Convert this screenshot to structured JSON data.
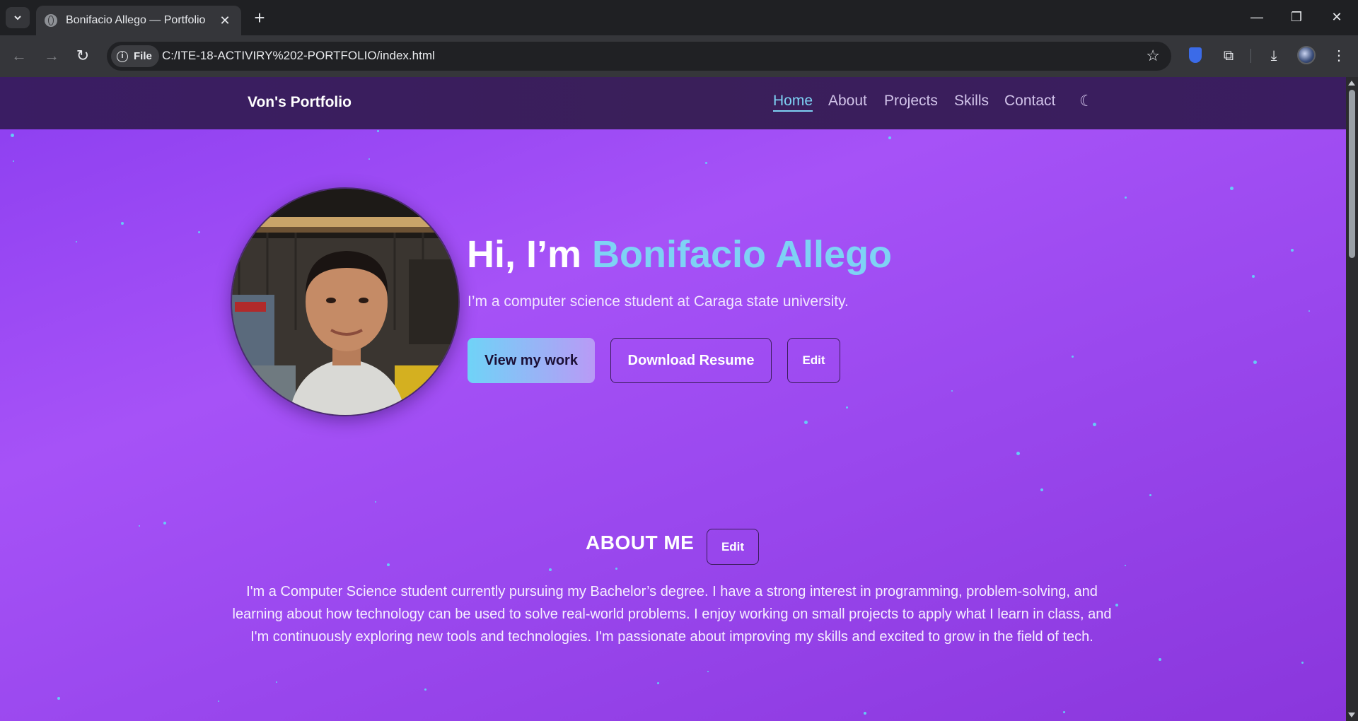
{
  "browser": {
    "tab_title": "Bonifacio Allego — Portfolio",
    "url_chip": "File",
    "url": "C:/ITE-18-ACTIVIRY%202-PORTFOLIO/index.html"
  },
  "site": {
    "brand": "Von's Portfolio",
    "nav": [
      {
        "label": "Home",
        "active": true
      },
      {
        "label": "About",
        "active": false
      },
      {
        "label": "Projects",
        "active": false
      },
      {
        "label": "Skills",
        "active": false
      },
      {
        "label": "Contact",
        "active": false
      }
    ],
    "theme_toggle_icon": "moon-icon"
  },
  "hero": {
    "greeting": "Hi, I’m ",
    "name": "Bonifacio Allego",
    "subtitle": "I’m a computer science student at Caraga state university.",
    "primary_button": "View my work",
    "secondary_button": "Download Resume",
    "edit_button": "Edit"
  },
  "about": {
    "title": "ABOUT ME",
    "edit_button": "Edit",
    "text": "I'm a Computer Science student currently pursuing my Bachelor’s degree. I have a strong interest in programming, problem-solving, and learning about how technology can be used to solve real-world problems. I enjoy working on small projects to apply what I learn in class, and I'm continuously exploring new tools and technologies. I'm passionate about improving my skills and excited to grow in the field of tech."
  },
  "colors": {
    "accent": "#7ed2f4",
    "background": "#a652f7",
    "nav_bg": "#3a1f5a"
  }
}
